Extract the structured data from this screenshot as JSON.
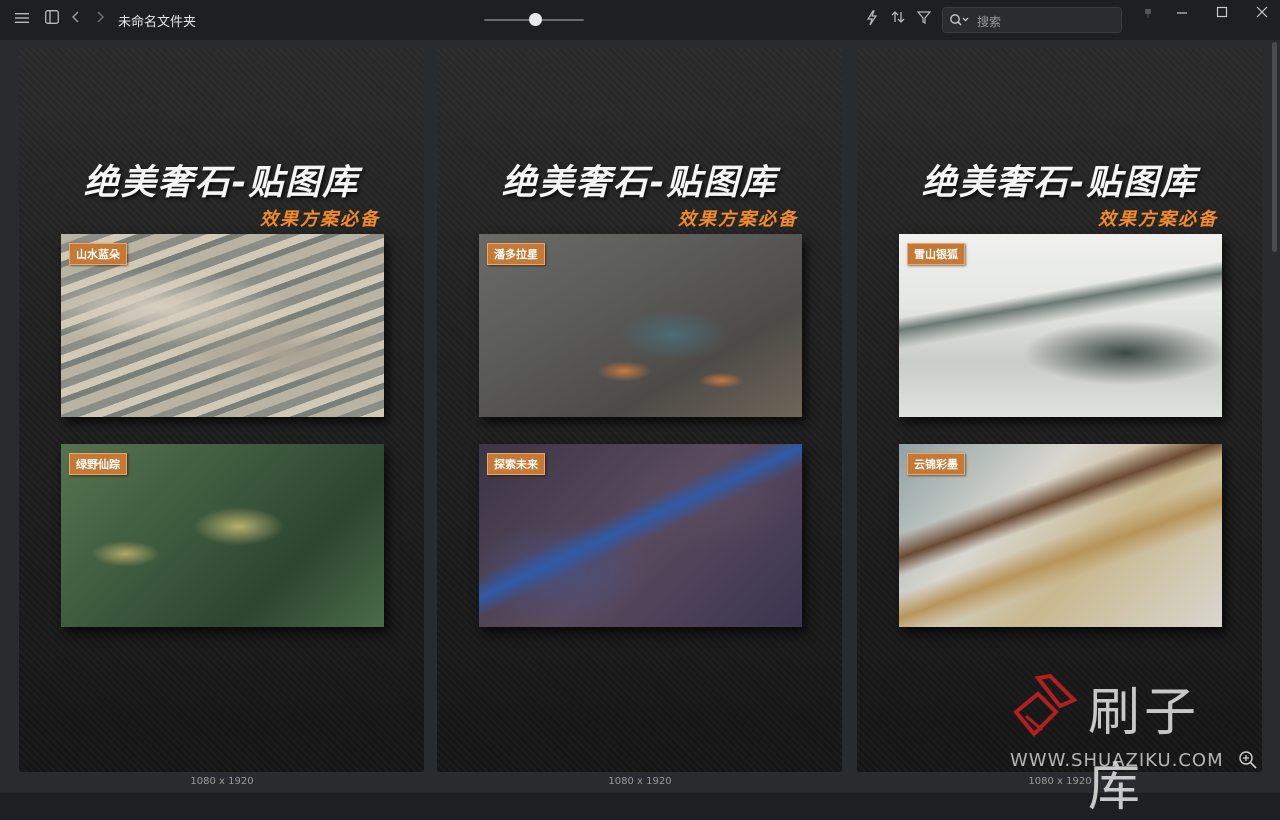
{
  "window": {
    "title": "未命名文件夹",
    "zoom_level": 0.5
  },
  "search": {
    "placeholder": "搜索"
  },
  "cards": [
    {
      "title": "绝美奢石-贴图库",
      "subtitle": "效果方案必备",
      "stones": [
        {
          "label": "山水蓝朵",
          "colors": [
            "#b9b3a4",
            "#8c8d86",
            "#d1c9b8",
            "#6f7671"
          ]
        },
        {
          "label": "绿野仙踪",
          "colors": [
            "#3d5a3e",
            "#56734f",
            "#9ba96c",
            "#2d4530"
          ]
        }
      ],
      "dimensions": "1080 x 1920"
    },
    {
      "title": "绝美奢石-贴图库",
      "subtitle": "效果方案必备",
      "stones": [
        {
          "label": "潘多拉星",
          "colors": [
            "#5a5a58",
            "#7c6a55",
            "#4b6a73",
            "#c7793f"
          ]
        },
        {
          "label": "探索未来",
          "colors": [
            "#3b3545",
            "#5a4a5e",
            "#2f5aa8",
            "#6a5d6d"
          ]
        }
      ],
      "dimensions": "1080 x 1920"
    },
    {
      "title": "绝美奢石-贴图库",
      "subtitle": "效果方案必备",
      "stones": [
        {
          "label": "雪山银狐",
          "colors": [
            "#f0f1ef",
            "#c9cdc9",
            "#3d4744",
            "#6c7874"
          ]
        },
        {
          "label": "云锦彩墨",
          "colors": [
            "#d8d6cf",
            "#b8955a",
            "#6b4a33",
            "#8da1a3"
          ]
        }
      ],
      "dimensions": "1080 x 1920"
    }
  ],
  "watermark": {
    "brand": "刷子库",
    "url": "WWW.SHUAZIKU.COM"
  }
}
